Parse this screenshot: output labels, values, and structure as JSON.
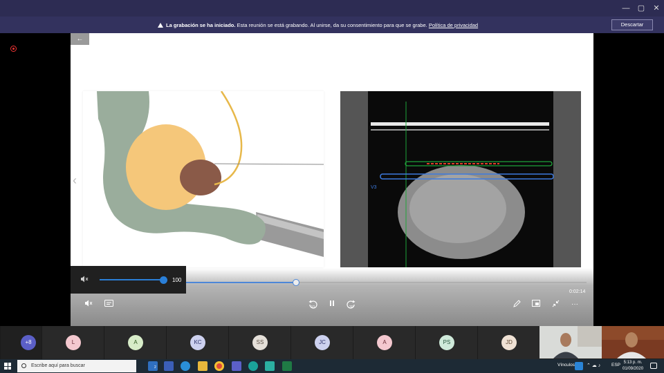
{
  "window": {
    "minimize": "—",
    "maximize": "▢",
    "close": "✕"
  },
  "banner": {
    "bold_text": "La grabación se ha iniciado.",
    "text": " Esta reunión se está grabando. Al unirse, da su consentimiento para que se grabe. ",
    "link": "Política de privacidad",
    "discard_label": "Descartar"
  },
  "viewer": {
    "back_arrow": "←",
    "ultrasound_label": "V3",
    "time": "0:02:14",
    "progress": 0.43,
    "prev_chevron": "‹"
  },
  "volume": {
    "value": "100",
    "level": 1.0,
    "mute_icon": "🔇"
  },
  "controls": {
    "rewind_label": "10",
    "forward_label": "30",
    "pause": "⏸",
    "more": "···"
  },
  "participants": [
    {
      "initials": "+8",
      "bg": "#5b5fc7",
      "fg": "#ffffff"
    },
    {
      "initials": "L",
      "bg": "#f4c8cf",
      "fg": "#6b2b36"
    },
    {
      "initials": "A",
      "bg": "#d7ecc8",
      "fg": "#2f5a1f"
    },
    {
      "initials": "KC",
      "bg": "#cdd1ef",
      "fg": "#2e336b"
    },
    {
      "initials": "SS",
      "bg": "#e4dfd8",
      "fg": "#5b4f44"
    },
    {
      "initials": "JC",
      "bg": "#cdd1ef",
      "fg": "#2e336b"
    },
    {
      "initials": "A",
      "bg": "#f4c8cf",
      "fg": "#6b2b36"
    },
    {
      "initials": "PS",
      "bg": "#cfeada",
      "fg": "#25553c"
    },
    {
      "initials": "JD",
      "bg": "#efe1d4",
      "fg": "#5e4630"
    }
  ],
  "taskbar": {
    "search_placeholder": "Escribe aquí para buscar",
    "mail_badge": "2",
    "links_label": "Vínculos",
    "lang": "ESP",
    "time": "5:13 p. m.",
    "date": "01/09/2020"
  },
  "colors": {
    "teams_purple": "#2d2c53",
    "accent_blue": "#2a7fd8"
  }
}
